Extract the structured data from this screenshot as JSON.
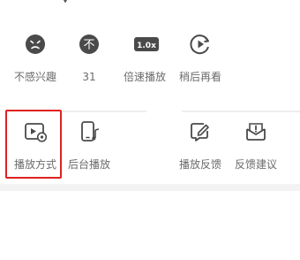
{
  "row1": [
    {
      "label": "不感兴趣",
      "icon": "dislike-face-icon"
    },
    {
      "label": "31",
      "icon": "coin-icon",
      "icon_glyph": "不"
    },
    {
      "label": "倍速播放",
      "icon": "playback-speed-icon",
      "icon_glyph": "1.0x"
    },
    {
      "label": "稍后再看",
      "icon": "watch-later-icon"
    }
  ],
  "row2": [
    {
      "label": "播放方式",
      "icon": "play-mode-icon"
    },
    {
      "label": "后台播放",
      "icon": "background-play-icon"
    },
    {
      "label": "播放反馈",
      "icon": "playback-feedback-icon"
    },
    {
      "label": "反馈建议",
      "icon": "feedback-suggestion-icon"
    }
  ],
  "colors": {
    "icon_dark": "#4a4a4a",
    "label_gray": "#6b6b6b",
    "highlight_red": "#e02020",
    "divider": "#ededed"
  }
}
